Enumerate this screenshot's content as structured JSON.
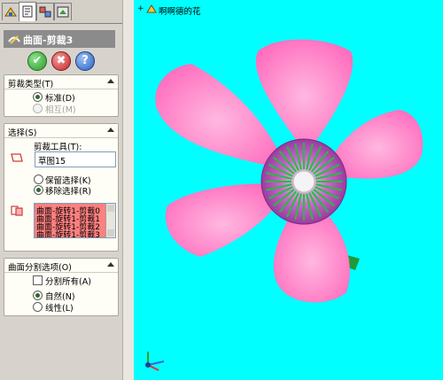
{
  "feature_title": "曲面-剪裁3",
  "icons": {
    "tabs": [
      "feature-manager-icon",
      "property-manager-icon",
      "configuration-manager-icon",
      "dimxpert-icon"
    ],
    "title": "trim-surface-icon",
    "ok": "checkmark-icon",
    "cancel": "x-icon",
    "help": "question-mark-icon",
    "trim_tool": "sketch-profile-icon",
    "bodies": "surface-bodies-icon",
    "tree_node": "part-icon"
  },
  "colors": {
    "viewport_bg": "#00FFFF",
    "petal": "#FF80C0",
    "center": "#B040B0",
    "stamens": "#20C040",
    "list_selection": "#FF8080",
    "title_bar": "#8B8B8B"
  },
  "trim_type": {
    "header": "剪裁类型(T)",
    "options": [
      {
        "label": "标准(D)",
        "selected": true,
        "enabled": true
      },
      {
        "label": "相互(M)",
        "selected": false,
        "enabled": false
      }
    ]
  },
  "selections": {
    "header": "选择(S)",
    "trim_tool_label": "剪裁工具(T):",
    "trim_tool_value": "草图15",
    "options": [
      {
        "label": "保留选择(K)",
        "selected": false
      },
      {
        "label": "移除选择(R)",
        "selected": true
      }
    ],
    "bodies": [
      "曲面-旋转1-剪裁0",
      "曲面-旋转1-剪裁1",
      "曲面-旋转1-剪裁2",
      "曲面-旋转1-剪裁3"
    ]
  },
  "split_options": {
    "header": "曲面分割选项(O)",
    "split_all_label": "分割所有(A)",
    "split_all_checked": false,
    "options": [
      {
        "label": "自然(N)",
        "selected": true
      },
      {
        "label": "线性(L)",
        "selected": false
      }
    ]
  },
  "viewport": {
    "tree_root_label": "啊啊德的花"
  }
}
